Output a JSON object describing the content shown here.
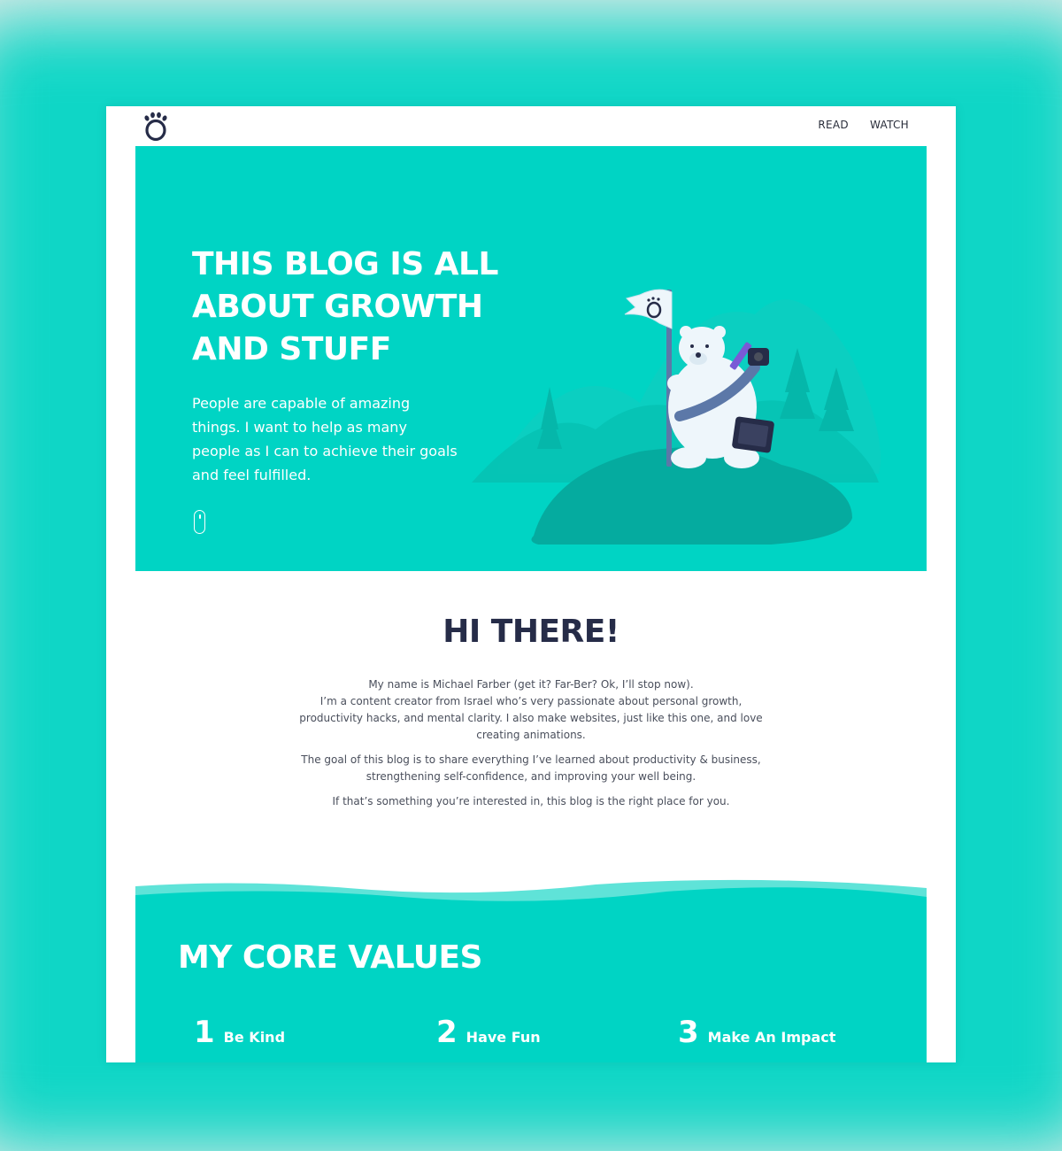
{
  "nav": {
    "items": [
      "READ",
      "WATCH"
    ]
  },
  "hero": {
    "title": "THIS BLOG IS ALL ABOUT GROWTH AND STUFF",
    "text": "People are capable of amazing things. I want to help as many people as I can to achieve their goals and feel fulfilled."
  },
  "intro": {
    "heading": "HI THERE!",
    "paragraph1_line1": "My name is Michael Farber (get it? Far-Ber? Ok, I’ll stop now).",
    "paragraph1_line2": "I’m a content creator from Israel who’s very passionate about personal growth, productivity hacks, and mental clarity. I also make websites, just like this one, and love creating animations.",
    "paragraph2": "The goal of this blog is to share everything I’ve learned about productivity & business, strengthening self-confidence, and improving your well being.",
    "paragraph3": "If that’s something you’re interested in, this blog is the right place for you."
  },
  "values": {
    "title": "MY CORE VALUES",
    "items": [
      {
        "num": "1",
        "label": "Be Kind"
      },
      {
        "num": "2",
        "label": "Have Fun"
      },
      {
        "num": "3",
        "label": "Make An Impact"
      }
    ]
  },
  "colors": {
    "accent": "#00d4c4",
    "heading_dark": "#262c48",
    "body_text": "#4a4f5c"
  },
  "icons": {
    "logo": "paw-icon",
    "scroll": "mouse-scroll-icon"
  }
}
